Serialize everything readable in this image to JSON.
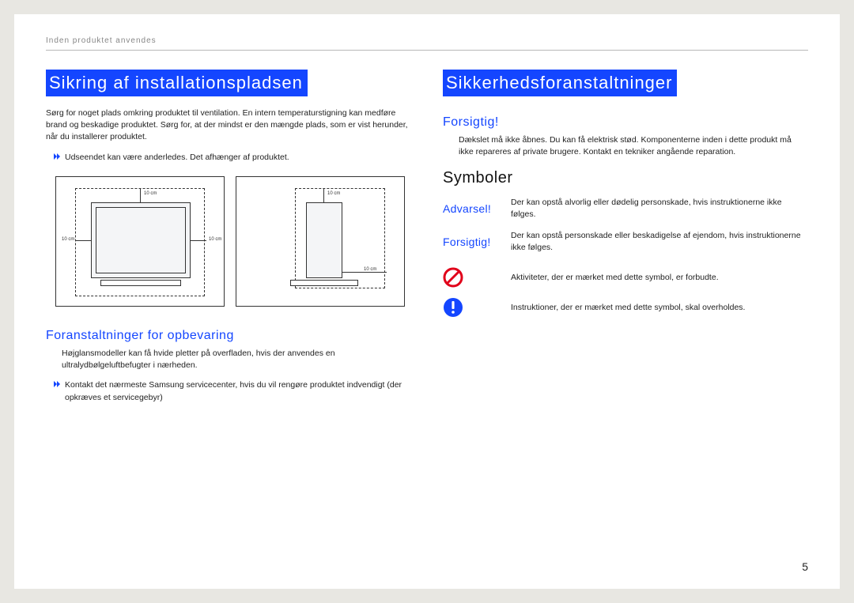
{
  "header": {
    "breadcrumb": "Inden produktet anvendes"
  },
  "left": {
    "title": "Sikring af installationspladsen",
    "intro": "Sørg for noget plads omkring produktet til ventilation. En intern temperaturstigning kan medføre brand og beskadige produktet. Sørg for, at der mindst er den mængde plads, som er vist herunder, når du installerer produktet.",
    "bullet1": "Udseendet kan være anderledes. Det afhænger af produktet.",
    "diagram_front": {
      "top": "10 cm",
      "left": "10 cm",
      "right": "10 cm"
    },
    "diagram_side": {
      "top": "10 cm",
      "right": "10 cm"
    },
    "storage_heading": "Foranstaltninger for opbevaring",
    "storage_text": "Højglansmodeller kan få hvide pletter på overfladen, hvis der anvendes en ultralydbølgeluftbefugter i nærheden.",
    "storage_bullet": "Kontakt det nærmeste Samsung servicecenter, hvis du vil rengøre produktet indvendigt (der opkræves et servicegebyr)"
  },
  "right": {
    "title": "Sikkerhedsforanstaltninger",
    "caution_heading": "Forsigtig!",
    "caution_text": "Dækslet må ikke åbnes. Du kan få elektrisk stød. Komponenterne inden i dette produkt må ikke repareres af private brugere. Kontakt en tekniker angående reparation.",
    "symbols_heading": "Symboler",
    "symbols": {
      "warning_label": "Advarsel!",
      "warning_text": "Der kan opstå alvorlig eller dødelig personskade, hvis instruktionerne ikke følges.",
      "caution_label": "Forsigtig!",
      "caution_text": "Der kan opstå personskade eller beskadigelse af ejendom, hvis instruktionerne ikke følges.",
      "prohibit_text": "Aktiviteter, der er mærket med dette symbol, er forbudte.",
      "must_text": "Instruktioner, der er mærket med dette symbol, skal overholdes."
    }
  },
  "page_number": "5"
}
